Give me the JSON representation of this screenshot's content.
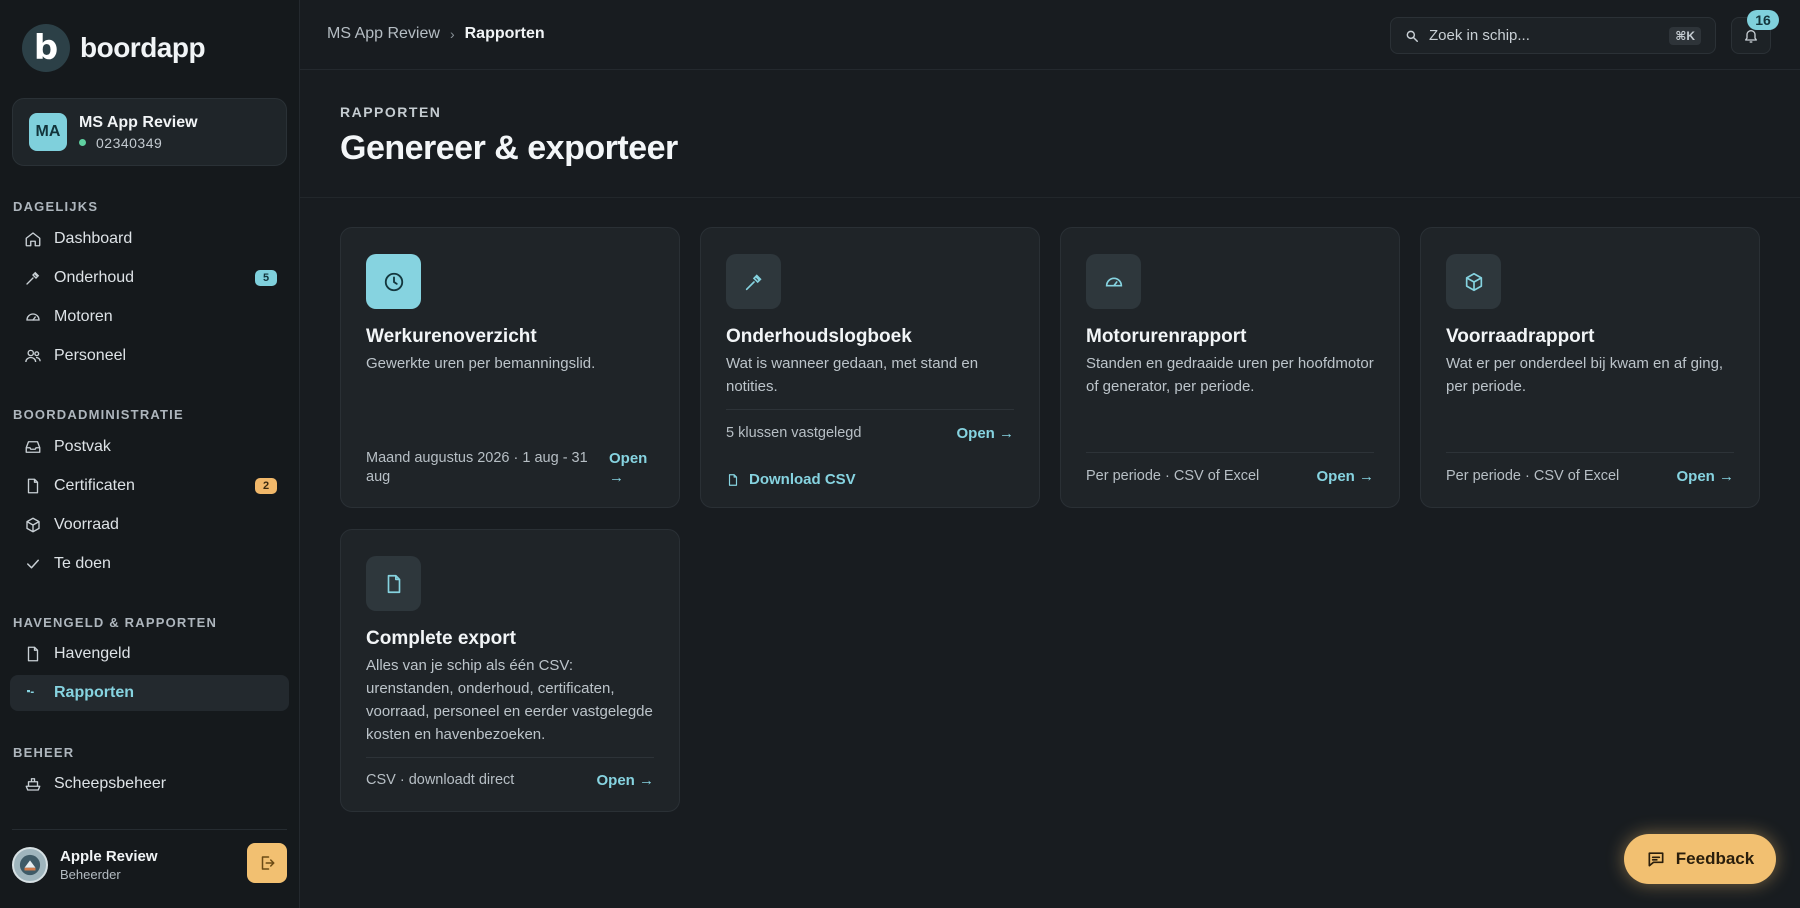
{
  "app": {
    "name": "boordapp",
    "logo_letter": "b"
  },
  "vessel": {
    "initials": "MA",
    "name": "MS App Review",
    "id": "02340349"
  },
  "sidebar": {
    "sections": [
      {
        "label": "DAGELIJKS"
      },
      {
        "label": "BOORDADMINISTRATIE"
      },
      {
        "label": "HAVENGELD & RAPPORTEN"
      },
      {
        "label": "BEHEER"
      }
    ],
    "items": [
      {
        "label": "Dashboard",
        "icon": "home-icon"
      },
      {
        "label": "Onderhoud",
        "icon": "wrench-icon",
        "badge": "5"
      },
      {
        "label": "Motoren",
        "icon": "gauge-icon"
      },
      {
        "label": "Personeel",
        "icon": "users-icon"
      },
      {
        "label": "Postvak",
        "icon": "inbox-icon"
      },
      {
        "label": "Certificaten",
        "icon": "file-icon",
        "badge": "2"
      },
      {
        "label": "Voorraad",
        "icon": "box-icon"
      },
      {
        "label": "Te doen",
        "icon": "check-icon"
      },
      {
        "label": "Havengeld",
        "icon": "file-icon"
      },
      {
        "label": "Rapporten",
        "icon": "chart-icon",
        "active": true
      },
      {
        "label": "Scheepsbeheer",
        "icon": "ship-icon"
      }
    ]
  },
  "user": {
    "name": "Apple Review",
    "role": "Beheerder"
  },
  "topbar": {
    "breadcrumb": [
      "MS App Review",
      "Rapporten"
    ],
    "search_placeholder": "Zoek in schip...",
    "search_shortcut": "⌘K",
    "notification_count": "16"
  },
  "page": {
    "kicker": "RAPPORTEN",
    "title": "Genereer & exporteer"
  },
  "cards": [
    {
      "title": "Werkurenoverzicht",
      "description": "Gewerkte uren per bemanningslid.",
      "meta": "Maand augustus 2026 · 1 aug - 31 aug",
      "open_label": "Open →",
      "icon": "clock-icon"
    },
    {
      "title": "Onderhoudslogboek",
      "description": "Wat is wanneer gedaan, met stand en notities.",
      "meta": "5 klussen vastgelegd",
      "open_label": "Open →",
      "download_label": "Download CSV",
      "icon": "wrench-icon"
    },
    {
      "title": "Motorurenrapport",
      "description": "Standen en gedraaide uren per hoofdmotor of generator, per periode.",
      "meta": "Per periode · CSV of Excel",
      "open_label": "Open →",
      "icon": "gauge-icon"
    },
    {
      "title": "Voorraadrapport",
      "description": "Wat er per onderdeel bij kwam en af ging, per periode.",
      "meta": "Per periode · CSV of Excel",
      "open_label": "Open →",
      "icon": "box-icon"
    },
    {
      "title": "Complete export",
      "description": "Alles van je schip als één CSV: urenstanden, onderhoud, certificaten, voorraad, personeel en eerder vastgelegde kosten en havenbezoeken.",
      "meta": "CSV · downloadt direct",
      "open_label": "Open →",
      "icon": "file-icon"
    }
  ],
  "feedback": {
    "label": "Feedback"
  },
  "colors": {
    "accent": "#86d3e0",
    "amber": "#f2c071",
    "background": "#181c20",
    "card": "#1f2428"
  }
}
